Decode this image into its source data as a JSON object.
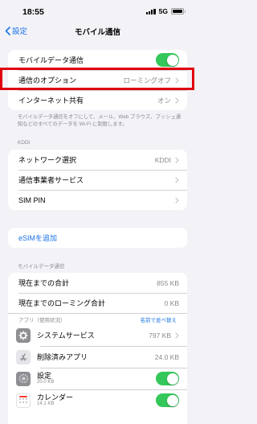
{
  "status_bar": {
    "time": "18:55",
    "network": "5G"
  },
  "nav": {
    "back_label": "設定",
    "title": "モバイル通信"
  },
  "group1": {
    "rows": [
      {
        "label": "モバイルデータ通信",
        "toggle_on": true
      },
      {
        "label": "通信のオプション",
        "value": "ローミングオフ"
      },
      {
        "label": "インターネット共有",
        "value": "オン"
      }
    ]
  },
  "footnote": "モバイルデータ通信をオフにして、メール、Web ブラウズ、プッシュ通知などのすべてのデータを Wi-Fi に制限します。",
  "carrier_section": {
    "header": "KDDI",
    "rows": [
      {
        "label": "ネットワーク選択",
        "value": "KDDI"
      },
      {
        "label": "通信事業者サービス"
      },
      {
        "label": "SIM PIN"
      }
    ]
  },
  "esim": {
    "label": "eSIMを追加"
  },
  "usage_section": {
    "header": "モバイルデータ通信",
    "rows": [
      {
        "label": "現在までの合計",
        "value": "855 KB"
      },
      {
        "label": "現在までのローミング合計",
        "value": "0 KB"
      }
    ],
    "apps_header": "アプリ（使用状況）",
    "sort_label": "名前で並べ替え",
    "apps": [
      {
        "name": "システムサービス",
        "usage": "797 KB",
        "icon": "gear-icon"
      },
      {
        "name": "削除済みアプリ",
        "usage": "24.0 KB",
        "icon": "app-store-icon"
      },
      {
        "name": "設定",
        "sub": "20.0 KB",
        "icon": "settings-icon",
        "toggle_on": true
      },
      {
        "name": "カレンダー",
        "sub": "14.1 KB",
        "icon": "calendar-icon",
        "toggle_on": true
      }
    ]
  },
  "colors": {
    "accent": "#1a73e8",
    "toggle_on": "#34c759",
    "highlight": "#e0000f"
  }
}
